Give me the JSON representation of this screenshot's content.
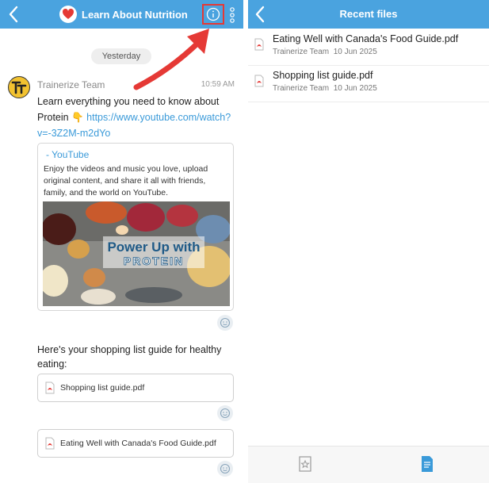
{
  "chat": {
    "title": "Learn About Nutrition",
    "date_divider": "Yesterday",
    "sender": "Trainerize Team",
    "time": "10:59 AM",
    "message1_text": "Learn everything you need to know about Protein",
    "message1_emoji": "👇",
    "message1_link": "https://www.youtube.com/watch?v=-3Z2M-m2dYo",
    "link_preview": {
      "title": "- YouTube",
      "description": "Enjoy the videos and music you love, upload original content, and share it all with friends, family, and the world on YouTube.",
      "image_caption_line1": "Power Up with",
      "image_caption_line2": "PROTEIN"
    },
    "message2_text": "Here's your shopping list guide for healthy eating:",
    "attachments": [
      {
        "name": "Shopping list guide.pdf"
      },
      {
        "name": "Eating Well with Canada's Food Guide.pdf"
      }
    ]
  },
  "recent": {
    "title": "Recent files",
    "files": [
      {
        "name": "Eating Well with Canada's Food Guide.pdf",
        "author": "Trainerize Team",
        "date": "10 Jun 2025"
      },
      {
        "name": "Shopping list guide.pdf",
        "author": "Trainerize Team",
        "date": "10 Jun 2025"
      }
    ]
  },
  "colors": {
    "header": "#4aa3df",
    "link": "#3a9ad9",
    "highlight": "#e53935",
    "pdf": "#e53935"
  },
  "icons": [
    "back-arrow-icon",
    "heart-icon",
    "info-icon",
    "more-vertical-icon",
    "reaction-icon",
    "pdf-icon",
    "starred-tab-icon",
    "files-tab-icon",
    "annotation-arrow"
  ]
}
